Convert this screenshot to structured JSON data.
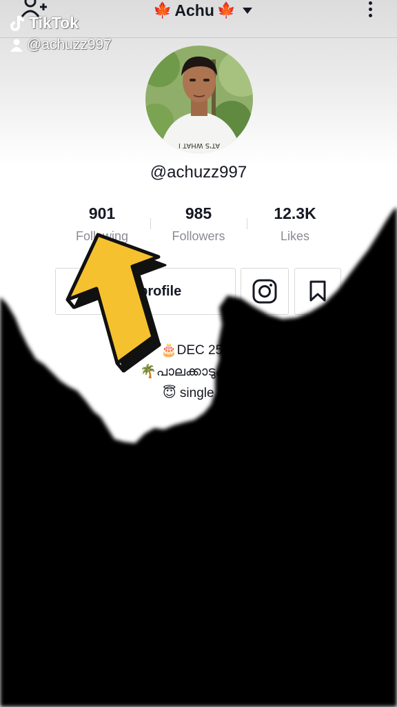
{
  "watermark": {
    "brand": "TikTok",
    "username": "@achuzz997"
  },
  "header": {
    "leaf_left": "🍁",
    "title": "Achu",
    "leaf_right": "🍁"
  },
  "profile": {
    "handle": "@achuzz997",
    "avatar_shirt_text": "AT'S WHAT I"
  },
  "stats": [
    {
      "value": "901",
      "label": "Following"
    },
    {
      "value": "985",
      "label": "Followers"
    },
    {
      "value": "12.3K",
      "label": "Likes"
    }
  ],
  "actions": {
    "edit_profile_label": "Edit profile"
  },
  "bio": {
    "line1": "🎂DEC 25😍",
    "line2": "🌴പാലക്കാടുകാരൻ",
    "line3": "😇 single life"
  },
  "colors": {
    "text": "#161823",
    "muted": "#8a8b91",
    "maple": "#c9741e",
    "arrow_fill": "#f5c12e",
    "ink": "#000000"
  }
}
